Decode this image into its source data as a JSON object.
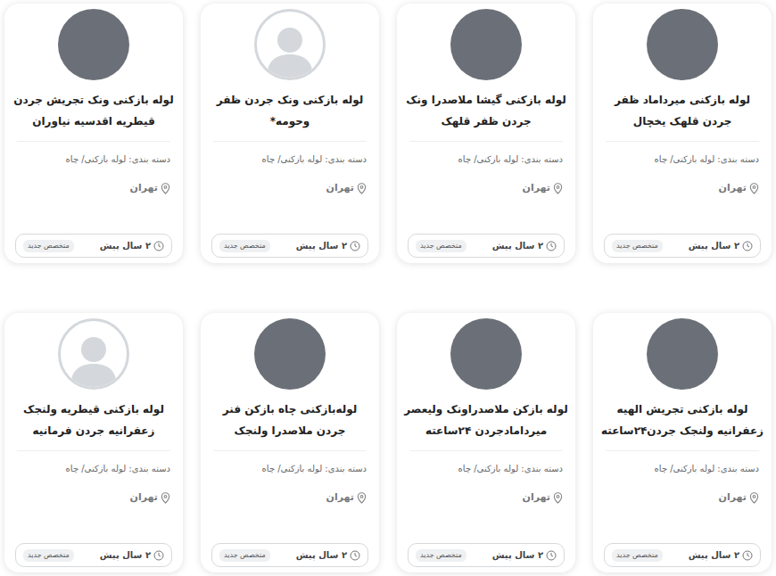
{
  "cards": [
    {
      "title": "لوله بازکنی میرداماد ظفر جردن قلهک یخچال",
      "kind": "photo",
      "category": "دسته بندی: لوله بازکنی/ چاه",
      "location": "تهران",
      "time": "۲ سال پیش",
      "badge": "متخصص جدید"
    },
    {
      "title": "لوله بازکنی گیشا ملاصدرا ونک جردن ظفر قلهک",
      "kind": "photo",
      "category": "دسته بندی: لوله بازکنی/ چاه",
      "location": "تهران",
      "time": "۲ سال پیش",
      "badge": "متخصص جدید"
    },
    {
      "title": "لوله بازکنی ونک جردن ظفر وحومه*",
      "kind": "placeholder",
      "category": "دسته بندی: لوله بازکنی/ چاه",
      "location": "تهران",
      "time": "۲ سال پیش",
      "badge": "متخصص جدید"
    },
    {
      "title": "لوله بازکنی ونک تجریش جردن قیطریه اقدسیه نیاوران",
      "kind": "photo",
      "category": "دسته بندی: لوله بازکنی/ چاه",
      "location": "تهران",
      "time": "۲ سال پیش",
      "badge": "متخصص جدید"
    },
    {
      "title": "لوله بازکنی تجریش الهیه زعفرانیه ولنجک جردن۲۴ساعته",
      "kind": "photo",
      "category": "دسته بندی: لوله بازکنی/ چاه",
      "location": "تهران",
      "time": "۲ سال پیش",
      "badge": "متخصص جدید"
    },
    {
      "title": "لوله بازکن ملاصدراونک ولیعصر میردامادجردن ۲۴ساعته",
      "kind": "photo",
      "category": "دسته بندی: لوله بازکنی/ چاه",
      "location": "تهران",
      "time": "۲ سال پیش",
      "badge": "متخصص جدید"
    },
    {
      "title": "لوله‌بازکنی چاه بازکن فنر جردن ملاصدرا ولنجک",
      "kind": "photo",
      "category": "دسته بندی: لوله بازکنی/ چاه",
      "location": "تهران",
      "time": "۲ سال پیش",
      "badge": "متخصص جدید"
    },
    {
      "title": "لوله بازکنی قیطریه ولنجک زعفرانیه جردن فرمانیه",
      "kind": "placeholder",
      "category": "دسته بندی: لوله بازکنی/ چاه",
      "location": "تهران",
      "time": "۲ سال پیش",
      "badge": "متخصص جدید"
    }
  ]
}
